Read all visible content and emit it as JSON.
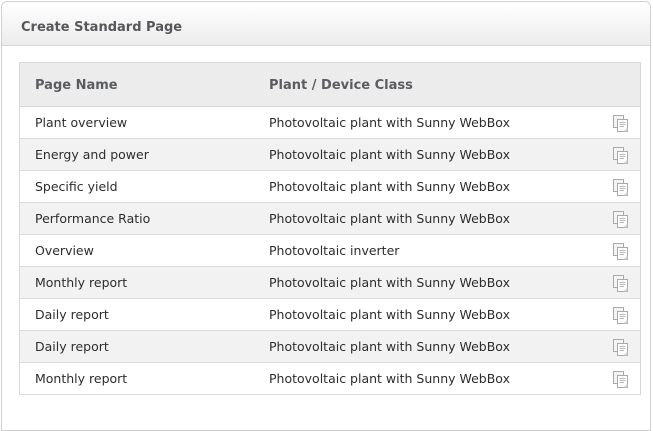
{
  "panel": {
    "title": "Create Standard Page"
  },
  "table": {
    "columns": {
      "page_name": "Page Name",
      "device_class": "Plant / Device Class"
    },
    "rows": [
      {
        "page_name": "Plant overview",
        "device_class": "Photovoltaic plant with Sunny WebBox",
        "action_icon": "copy-page-icon"
      },
      {
        "page_name": "Energy and power",
        "device_class": "Photovoltaic plant with Sunny WebBox",
        "action_icon": "copy-page-icon"
      },
      {
        "page_name": "Specific yield",
        "device_class": "Photovoltaic plant with Sunny WebBox",
        "action_icon": "copy-page-icon"
      },
      {
        "page_name": "Performance Ratio",
        "device_class": "Photovoltaic plant with Sunny WebBox",
        "action_icon": "copy-page-icon"
      },
      {
        "page_name": "Overview",
        "device_class": "Photovoltaic inverter",
        "action_icon": "copy-page-icon"
      },
      {
        "page_name": "Monthly report",
        "device_class": "Photovoltaic plant with Sunny WebBox",
        "action_icon": "copy-page-icon"
      },
      {
        "page_name": "Daily report",
        "device_class": "Photovoltaic plant with Sunny WebBox",
        "action_icon": "copy-page-icon"
      },
      {
        "page_name": "Daily report",
        "device_class": "Photovoltaic plant with Sunny WebBox",
        "action_icon": "copy-page-icon"
      },
      {
        "page_name": "Monthly report",
        "device_class": "Photovoltaic plant with Sunny WebBox",
        "action_icon": "copy-page-icon"
      }
    ]
  },
  "colors": {
    "row_alt": "#f2f2f2",
    "header_bg": "#ececec",
    "icon_gray": "#a9a9a9"
  }
}
